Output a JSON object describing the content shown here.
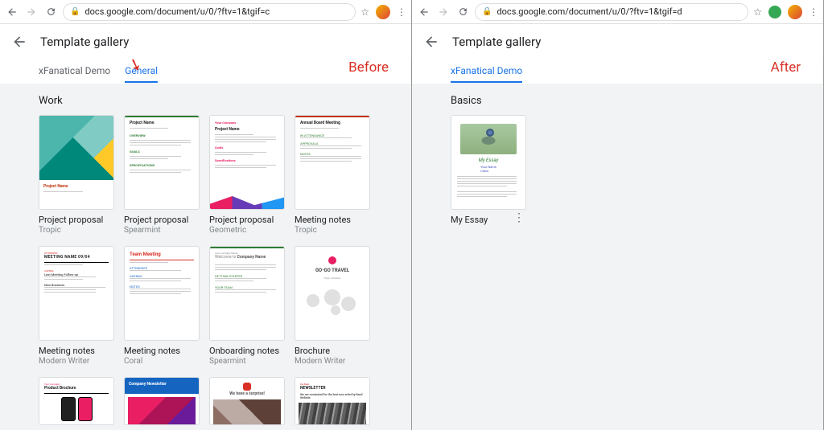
{
  "left": {
    "url": "docs.google.com/document/u/0/?ftv=1&tgif=c",
    "title": "Template gallery",
    "tabs": [
      "xFanatical Demo",
      "General"
    ],
    "active_tab": "General",
    "annotation": "Before",
    "section": "Work",
    "cards": [
      {
        "label": "Project proposal",
        "sub": "Tropic"
      },
      {
        "label": "Project proposal",
        "sub": "Spearmint"
      },
      {
        "label": "Project proposal",
        "sub": "Geometric"
      },
      {
        "label": "Meeting notes",
        "sub": "Tropic"
      },
      {
        "label": "Meeting notes",
        "sub": "Modern Writer"
      },
      {
        "label": "Meeting notes",
        "sub": "Coral"
      },
      {
        "label": "Onboarding notes",
        "sub": "Spearmint"
      },
      {
        "label": "Brochure",
        "sub": "Modern Writer"
      }
    ],
    "thumb_text": {
      "project_name": "Project Name",
      "annual_board": "Annual Board Meeting",
      "meeting_name": "MEETING NAME 09/04",
      "team_meeting": "Team Meeting",
      "welcome": "Welcome to Company Name",
      "gogo": "GO-GO TRAVEL",
      "product_brochure": "Product Brochure",
      "company_newsletter": "Company Newsletter",
      "surprise": "We have a surprise!",
      "newsletter": "NEWSLETTER",
      "nominated": "We are nominated for the best new artist by Band Website"
    }
  },
  "right": {
    "url": "docs.google.com/document/u/0/?ftv=1&tgif=d",
    "title": "Template gallery",
    "tabs": [
      "xFanatical Demo"
    ],
    "active_tab": "xFanatical Demo",
    "annotation": "After",
    "section": "Basics",
    "cards": [
      {
        "label": "My Essay",
        "sub": ""
      }
    ],
    "thumb_text": {
      "essay_title": "My Essay"
    }
  }
}
